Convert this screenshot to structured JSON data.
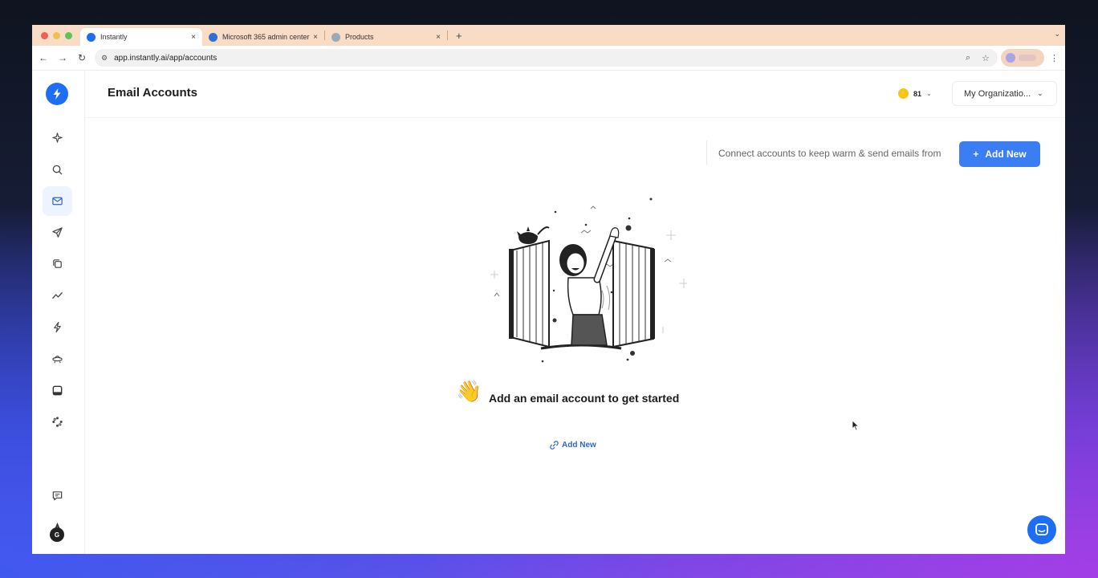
{
  "browser": {
    "tabs": [
      {
        "title": "Instantly",
        "active": true,
        "favicon_color": "#1d6ef2"
      },
      {
        "title": "Microsoft 365 admin center",
        "active": false,
        "favicon_color": "#2e6fd1"
      },
      {
        "title": "Products",
        "active": false,
        "favicon_color": "#9aa9b8"
      }
    ],
    "close_glyph": "×",
    "new_tab_glyph": "+",
    "url": "app.instantly.ai/app/accounts"
  },
  "sidebar": {
    "items": [
      {
        "icon": "sparkle-icon"
      },
      {
        "icon": "search-icon"
      },
      {
        "icon": "mail-icon",
        "active": true
      },
      {
        "icon": "send-icon"
      },
      {
        "icon": "copy-icon"
      },
      {
        "icon": "analytics-icon"
      },
      {
        "icon": "bolt-icon"
      },
      {
        "icon": "ufo-icon"
      },
      {
        "icon": "inbox-icon"
      },
      {
        "icon": "integrations-icon"
      },
      {
        "icon": "feedback-icon"
      },
      {
        "icon": "font-icon"
      }
    ],
    "avatar_initial": "G"
  },
  "header": {
    "title": "Email Accounts",
    "credits": "81",
    "org_select": "My Organizatio..."
  },
  "main": {
    "connect_text": "Connect accounts to keep warm & send emails from",
    "add_new_button": "Add New",
    "add_new_plus": "+",
    "empty_state_emoji": "👋",
    "empty_state_text": "Add an email account to get started",
    "add_new_link": "Add New"
  },
  "colors": {
    "accent": "#3b7df3",
    "brand": "#1d6ef2",
    "link": "#2f66c9"
  }
}
